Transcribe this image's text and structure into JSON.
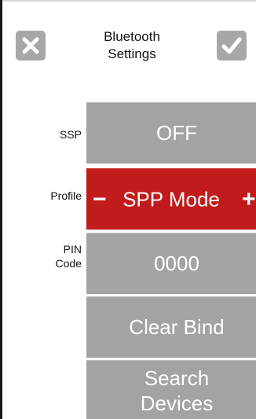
{
  "header": {
    "title_line1": "Bluetooth",
    "title_line2": "Settings",
    "close_icon": "close-x-icon",
    "confirm_icon": "checkmark-icon"
  },
  "settings": {
    "ssp": {
      "label": "SSP",
      "value": "OFF"
    },
    "profile": {
      "label": "Profile",
      "value": "SPP Mode",
      "decrement": "−",
      "increment": "+"
    },
    "pin": {
      "label_line1": "PIN",
      "label_line2": "Code",
      "value": "0000"
    },
    "clear_bind": "Clear Bind",
    "search_devices_line1": "Search",
    "search_devices_line2": "Devices"
  },
  "colors": {
    "button_gray": "#a3a3a3",
    "accent_red": "#c11b1b",
    "icon_bg": "#a7a7a7"
  }
}
